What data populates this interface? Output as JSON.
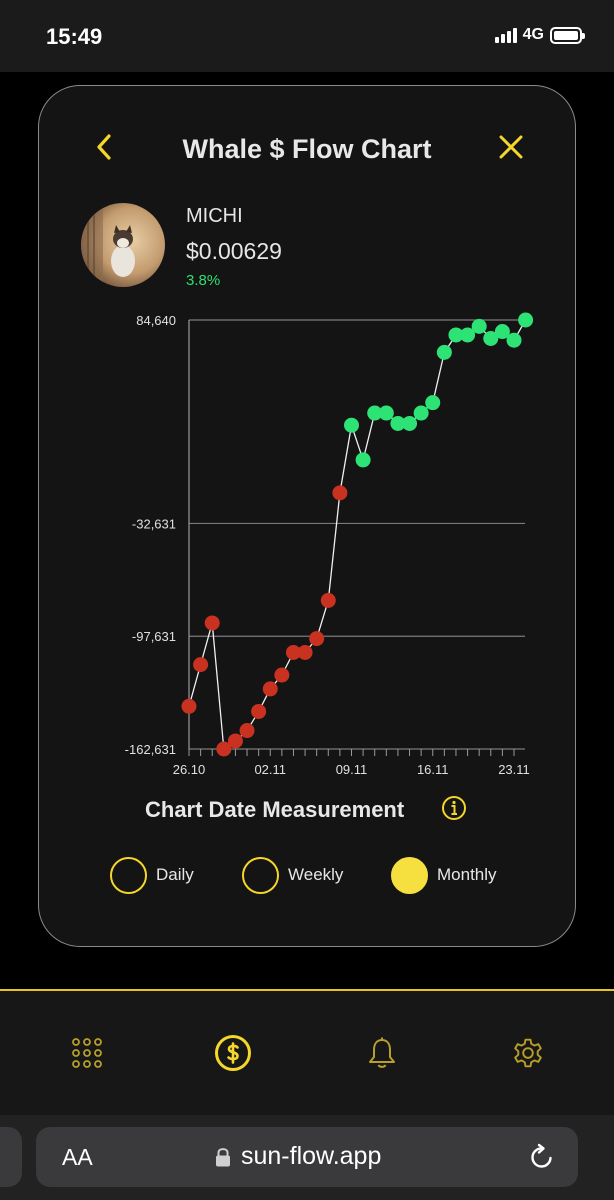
{
  "status": {
    "time": "15:49",
    "network": "4G"
  },
  "card": {
    "title": "Whale $ Flow Chart",
    "token_name": "MICHI",
    "price": "$0.00629",
    "change": "3.8%"
  },
  "chart_data": {
    "type": "scatter",
    "y_ticks": [
      "84,640",
      "-32,631",
      "-97,631",
      "-162,631"
    ],
    "y_tick_values": [
      84640,
      -32631,
      -97631,
      -162631
    ],
    "x_ticks": [
      "26.10",
      "02.11",
      "09.11",
      "16.11",
      "23.11"
    ],
    "x_tick_dates": [
      "2024-10-26",
      "2024-11-02",
      "2024-11-09",
      "2024-11-16",
      "2024-11-23"
    ],
    "ylim": [
      -162631,
      84640
    ],
    "grid": true,
    "negative_color": "#c93120",
    "positive_color": "#2ee375",
    "points": [
      {
        "x": "2024-10-26",
        "y": -138000
      },
      {
        "x": "2024-10-27",
        "y": -114000
      },
      {
        "x": "2024-10-28",
        "y": -90000
      },
      {
        "x": "2024-10-29",
        "y": -162631
      },
      {
        "x": "2024-10-30",
        "y": -158000
      },
      {
        "x": "2024-10-31",
        "y": -152000
      },
      {
        "x": "2024-11-01",
        "y": -141000
      },
      {
        "x": "2024-11-02",
        "y": -128000
      },
      {
        "x": "2024-11-03",
        "y": -120000
      },
      {
        "x": "2024-11-04",
        "y": -107000
      },
      {
        "x": "2024-11-05",
        "y": -107000
      },
      {
        "x": "2024-11-06",
        "y": -99000
      },
      {
        "x": "2024-11-07",
        "y": -77000
      },
      {
        "x": "2024-11-08",
        "y": -15000
      },
      {
        "x": "2024-11-09",
        "y": 24000
      },
      {
        "x": "2024-11-10",
        "y": 4000
      },
      {
        "x": "2024-11-11",
        "y": 31000
      },
      {
        "x": "2024-11-12",
        "y": 31000
      },
      {
        "x": "2024-11-13",
        "y": 25000
      },
      {
        "x": "2024-11-14",
        "y": 25000
      },
      {
        "x": "2024-11-15",
        "y": 31000
      },
      {
        "x": "2024-11-16",
        "y": 37000
      },
      {
        "x": "2024-11-17",
        "y": 66000
      },
      {
        "x": "2024-11-18",
        "y": 76000
      },
      {
        "x": "2024-11-19",
        "y": 76000
      },
      {
        "x": "2024-11-20",
        "y": 81000
      },
      {
        "x": "2024-11-21",
        "y": 74000
      },
      {
        "x": "2024-11-22",
        "y": 78000
      },
      {
        "x": "2024-11-23",
        "y": 73000
      },
      {
        "x": "2024-11-24",
        "y": 84640
      }
    ]
  },
  "measurement": {
    "title": "Chart Date Measurement",
    "options": [
      {
        "label": "Daily",
        "selected": false
      },
      {
        "label": "Weekly",
        "selected": false
      },
      {
        "label": "Monthly",
        "selected": true
      }
    ]
  },
  "nav": {
    "accent": "#f5d62a",
    "icons": [
      "grid-icon",
      "dollar-icon",
      "bell-icon",
      "gear-icon"
    ],
    "active": "dollar-icon"
  },
  "browser": {
    "text_size_label": "AA",
    "url": "sun-flow.app"
  }
}
